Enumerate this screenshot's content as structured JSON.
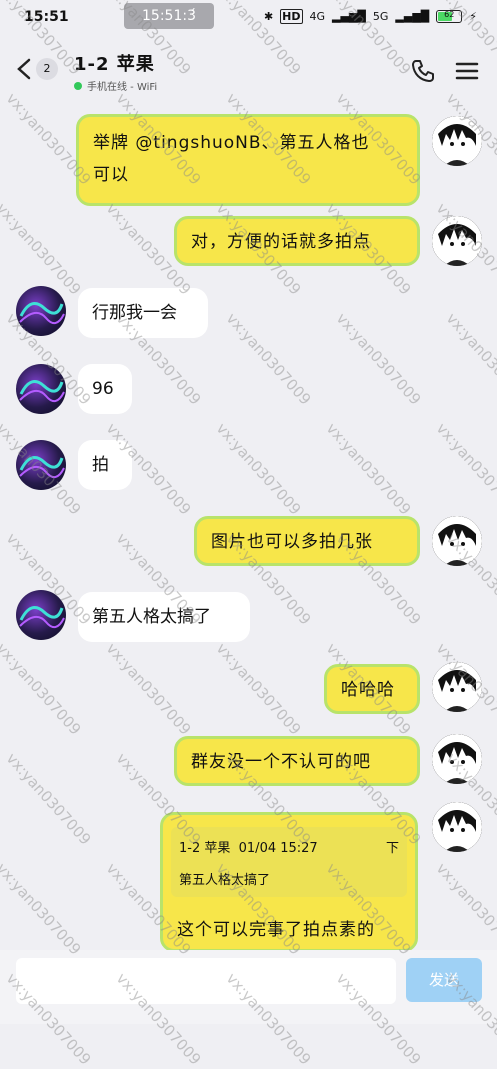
{
  "status": {
    "time": "15:51",
    "overlay_time": "15:51:3́",
    "network_4g": "4G",
    "network_5g": "5G",
    "hd": "HD",
    "battery": "62",
    "battery_level": 62
  },
  "header": {
    "unread_count": "2",
    "title": "1-2 苹果",
    "subtitle": "手机在线 - WiFi"
  },
  "messages": [
    {
      "side": "me",
      "text1": "举牌 @tingshuoNB、第五人格也",
      "text2": "可以"
    },
    {
      "side": "me",
      "text": "对，方便的话就多拍点"
    },
    {
      "side": "other",
      "text": "行那我一会"
    },
    {
      "side": "other",
      "text": "96"
    },
    {
      "side": "other",
      "text": "拍"
    },
    {
      "side": "me",
      "text": "图片也可以多拍几张"
    },
    {
      "side": "other",
      "text": "第五人格太搞了"
    },
    {
      "side": "me",
      "text": "哈哈哈"
    },
    {
      "side": "me",
      "text": "群友没一个不认可的吧"
    }
  ],
  "quote": {
    "sender": "1-2 苹果",
    "time": "01/04 15:27",
    "marker": "下",
    "quoted_text": "第五人格太搞了",
    "reply": "这个可以完事了拍点素的"
  },
  "input": {
    "placeholder": "",
    "send_label": "发送"
  },
  "watermark": "vx:yan0307009",
  "icons": [
    "back-icon",
    "phone-icon",
    "menu-icon",
    "bluetooth-icon",
    "signal-icon",
    "battery-icon"
  ],
  "colors": {
    "my_bubble": "#f7e64a",
    "my_bubble_border": "#b8e36a",
    "send_button": "#9fd1f5",
    "online_dot": "#32c85a"
  }
}
